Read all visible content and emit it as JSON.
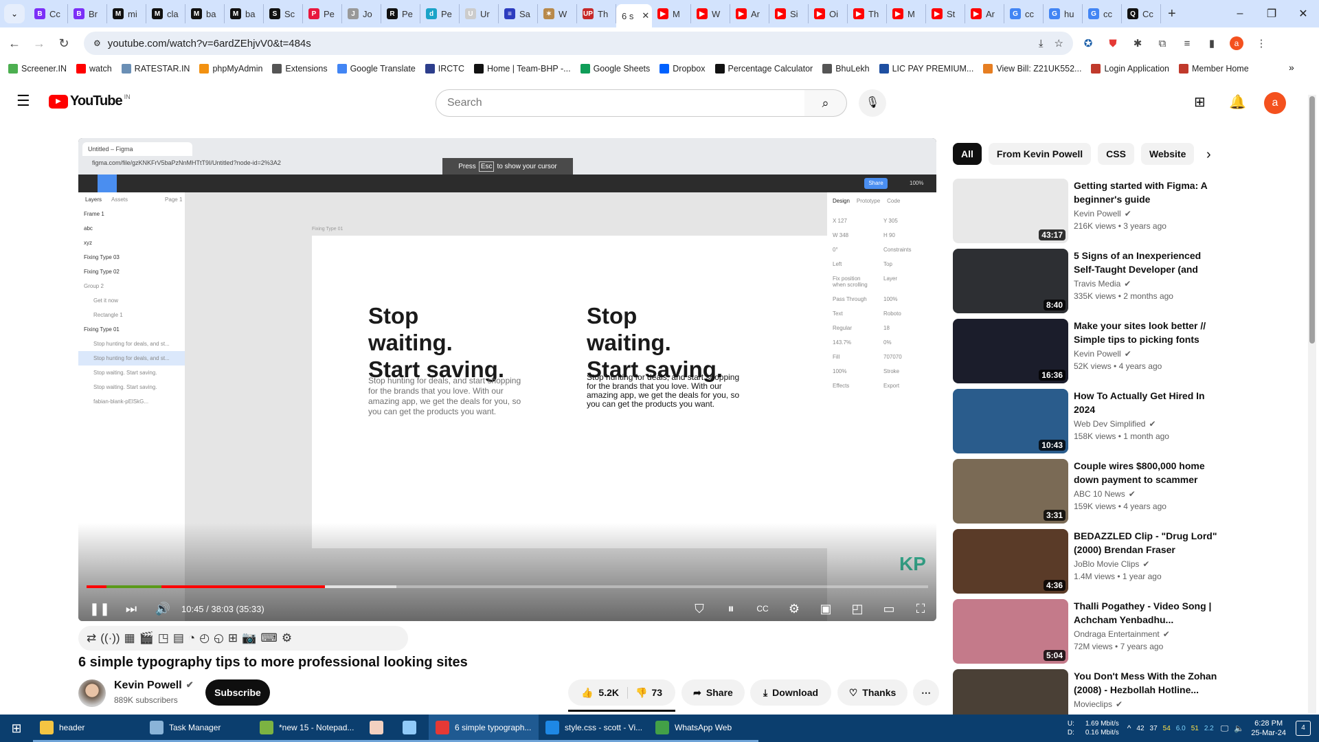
{
  "browser": {
    "tabs": [
      {
        "label": "Cc",
        "color": "#7b2ff7",
        "glyph": "B"
      },
      {
        "label": "Br",
        "color": "#7b2ff7",
        "glyph": "B"
      },
      {
        "label": "mi",
        "color": "#111",
        "glyph": "M"
      },
      {
        "label": "cla",
        "color": "#111",
        "glyph": "M"
      },
      {
        "label": "ba",
        "color": "#111",
        "glyph": "M"
      },
      {
        "label": "ba",
        "color": "#111",
        "glyph": "M"
      },
      {
        "label": "Sc",
        "color": "#111",
        "glyph": "S"
      },
      {
        "label": "Pe",
        "color": "#e8173d",
        "glyph": "P"
      },
      {
        "label": "Jo",
        "color": "#999",
        "glyph": "J"
      },
      {
        "label": "Pe",
        "color": "#111",
        "glyph": "R"
      },
      {
        "label": "Pe",
        "color": "#1aa3c8",
        "glyph": "d"
      },
      {
        "label": "Ur",
        "color": "#ccc",
        "glyph": "U"
      },
      {
        "label": "Sa",
        "color": "#2c3cbf",
        "glyph": "≡"
      },
      {
        "label": "W",
        "color": "#b8894a",
        "glyph": "✶"
      },
      {
        "label": "Th",
        "color": "#c62828",
        "glyph": "UP"
      },
      {
        "label": "6 s",
        "color": "#fff",
        "glyph": "",
        "active": true
      },
      {
        "label": "M",
        "color": "#ff0000",
        "glyph": "▶"
      },
      {
        "label": "W",
        "color": "#ff0000",
        "glyph": "▶"
      },
      {
        "label": "Ar",
        "color": "#ff0000",
        "glyph": "▶"
      },
      {
        "label": "Si",
        "color": "#ff0000",
        "glyph": "▶"
      },
      {
        "label": "Oi",
        "color": "#ff0000",
        "glyph": "▶"
      },
      {
        "label": "Th",
        "color": "#ff0000",
        "glyph": "▶"
      },
      {
        "label": "M",
        "color": "#ff0000",
        "glyph": "▶"
      },
      {
        "label": "St",
        "color": "#ff0000",
        "glyph": "▶"
      },
      {
        "label": "Ar",
        "color": "#ff0000",
        "glyph": "▶"
      },
      {
        "label": "cc",
        "color": "#4285f4",
        "glyph": "G"
      },
      {
        "label": "hu",
        "color": "#4285f4",
        "glyph": "G"
      },
      {
        "label": "cc",
        "color": "#4285f4",
        "glyph": "G"
      },
      {
        "label": "Cc",
        "color": "#111",
        "glyph": "Q"
      }
    ],
    "url": "youtube.com/watch?v=6ardZEhjvV0&t=484s",
    "profile_initial": "a",
    "bookmarks": [
      {
        "label": "Screener.IN",
        "color": "#4caf50"
      },
      {
        "label": "watch",
        "color": "#ff0000"
      },
      {
        "label": "RATESTAR.IN",
        "color": "#6a8fb5"
      },
      {
        "label": "phpMyAdmin",
        "color": "#f29111"
      },
      {
        "label": "Extensions",
        "color": "#555"
      },
      {
        "label": "Google Translate",
        "color": "#4285f4"
      },
      {
        "label": "IRCTC",
        "color": "#2d3e8c"
      },
      {
        "label": "Home | Team-BHP -...",
        "color": "#111"
      },
      {
        "label": "Google Sheets",
        "color": "#0f9d58"
      },
      {
        "label": "Dropbox",
        "color": "#0061fe"
      },
      {
        "label": "Percentage Calculator",
        "color": "#111"
      },
      {
        "label": "BhuLekh",
        "color": "#555"
      },
      {
        "label": "LIC PAY PREMIUM...",
        "color": "#1e4fa1"
      },
      {
        "label": "View Bill: Z21UK552...",
        "color": "#e67e22"
      },
      {
        "label": "Login Application",
        "color": "#c0392b"
      },
      {
        "label": "Member Home",
        "color": "#c0392b"
      }
    ]
  },
  "youtube": {
    "logo_text": "YouTube",
    "region": "IN",
    "search_placeholder": "Search",
    "avatar_initial": "a",
    "player": {
      "figma": {
        "tab_title": "Untitled – Figma",
        "url": "figma.com/file/gzKNKFrV5baPzNnMHTtT9I/Untitled?node-id=2%3A2",
        "esc_hint_pre": "Press",
        "esc_key": "Esc",
        "esc_hint_post": "to show your cursor",
        "share": "Share",
        "zoom": "100%",
        "panel_tabs": [
          "Layers",
          "Assets",
          "Page 1"
        ],
        "layers": [
          "Frame 1",
          "abc",
          "xyz",
          "Fixing Type 03",
          "Fixing Type 02",
          "Group 2",
          "Get it now",
          "Rectangle 1",
          "Fixing Type 01",
          "Stop hunting for deals, and st...",
          "Stop hunting for deals, and st...",
          "Stop waiting. Start saving.",
          "Stop waiting. Start saving.",
          "fabian-blank-pElSkG..."
        ],
        "frame_label": "Fixing Type 01",
        "headline": "Stop waiting. Start saving.",
        "body": "Stop hunting for deals, and start shopping for the brands that you love. With our amazing app, we get the deals for you, so you can get the products you want.",
        "design_tabs": [
          "Design",
          "Prototype",
          "Code"
        ],
        "props": [
          "X 127",
          "Y 305",
          "W 348",
          "H 90",
          "0°",
          "Constraints",
          "Left",
          "Top",
          "Fix position when scrolling",
          "Layer",
          "Pass Through",
          "100%",
          "Text",
          "Roboto",
          "Regular",
          "18",
          "143.7%",
          "0%",
          "Fill",
          "707070",
          "100%",
          "Stroke",
          "Effects",
          "Export"
        ],
        "watermark": "KP"
      },
      "progress_played": 0.283,
      "progress_buffered": 0.368,
      "time": "10:45 / 38:03 (35:33)"
    },
    "video_title": "6 simple typography tips to more professional looking sites",
    "channel": {
      "name": "Kevin Powell",
      "subscribers": "889K subscribers",
      "subscribe": "Subscribe"
    },
    "actions": {
      "likes": "5.2K",
      "dislikes": "73",
      "share": "Share",
      "download": "Download",
      "thanks": "Thanks"
    },
    "chips": [
      "All",
      "From Kevin Powell",
      "CSS",
      "Website"
    ],
    "recommendations": [
      {
        "title": "Getting started with Figma: A beginner's guide",
        "channel": "Kevin Powell",
        "views": "216K views",
        "age": "3 years ago",
        "duration": "43:17",
        "thumb": "#e8e8e8"
      },
      {
        "title": "5 Signs of an Inexperienced Self-Taught Developer (and ho...",
        "channel": "Travis Media",
        "views": "335K views",
        "age": "2 months ago",
        "duration": "8:40",
        "thumb": "#2d2f33"
      },
      {
        "title": "Make your sites look better // Simple tips to picking fonts",
        "channel": "Kevin Powell",
        "views": "52K views",
        "age": "4 years ago",
        "duration": "16:36",
        "thumb": "#1b1d2b"
      },
      {
        "title": "How To Actually Get Hired In 2024",
        "channel": "Web Dev Simplified",
        "views": "158K views",
        "age": "1 month ago",
        "duration": "10:43",
        "thumb": "#2a5c8c"
      },
      {
        "title": "Couple wires $800,000 home down payment to scammer",
        "channel": "ABC 10 News",
        "views": "159K views",
        "age": "4 years ago",
        "duration": "3:31",
        "thumb": "#7a6a55"
      },
      {
        "title": "BEDAZZLED Clip - \"Drug Lord\" (2000) Brendan Fraser",
        "channel": "JoBlo Movie Clips",
        "views": "1.4M views",
        "age": "1 year ago",
        "duration": "4:36",
        "thumb": "#5a3b28"
      },
      {
        "title": "Thalli Pogathey - Video Song | Achcham Yenbadhu...",
        "channel": "Ondraga Entertainment",
        "views": "72M views",
        "age": "7 years ago",
        "duration": "5:04",
        "thumb": "#c47a8a"
      },
      {
        "title": "You Don't Mess With the Zohan (2008) - Hezbollah Hotline...",
        "channel": "Movieclips",
        "views": "",
        "age": "",
        "duration": "",
        "thumb": "#4a4036"
      }
    ]
  },
  "taskbar": {
    "items": [
      {
        "label": "header",
        "color": "#f4c542"
      },
      {
        "label": "Task Manager",
        "color": "#8ab4d8"
      },
      {
        "label": "*new 15 - Notepad...",
        "color": "#7cb342"
      },
      {
        "label": "",
        "color": "#f3d1c0"
      },
      {
        "label": "",
        "color": "#90caf9"
      },
      {
        "label": "6 simple typograph...",
        "color": "#e53935",
        "active": true
      },
      {
        "label": "style.css - scott - Vi...",
        "color": "#1e88e5"
      },
      {
        "label": "WhatsApp Web",
        "color": "#43a047"
      }
    ],
    "net_up": "1.69 Mbit/s",
    "net_down": "0.16 Mbit/s",
    "net_up_label": "U:",
    "net_down_label": "D:",
    "tray_nums": [
      "42",
      "37",
      "54",
      "6.0",
      "51",
      "2.2"
    ],
    "time": "6:28 PM",
    "date": "25-Mar-24",
    "notifications": "4"
  }
}
